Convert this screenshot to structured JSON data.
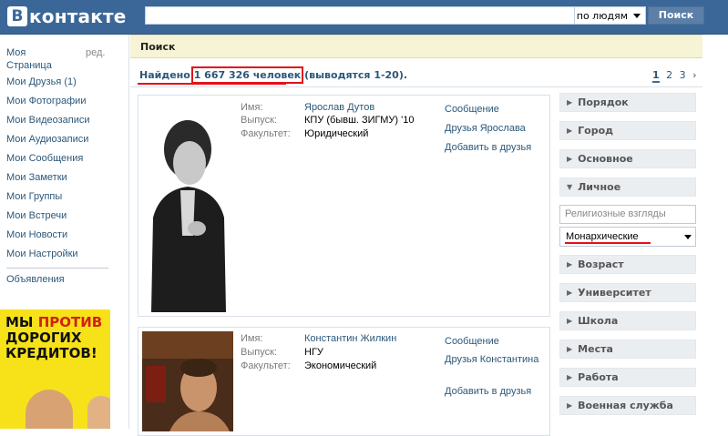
{
  "header": {
    "logo_letter": "В",
    "logo_text": "контакте",
    "search_value": "",
    "search_mode": "по людям",
    "search_button": "Поиск"
  },
  "sidebar": {
    "edit_label": "ред.",
    "items": [
      {
        "label": "Моя\nСтраница"
      },
      {
        "label": "Мои Друзья (1)"
      },
      {
        "label": "Мои Фотографии"
      },
      {
        "label": "Мои Видеозаписи"
      },
      {
        "label": "Мои Аудиозаписи"
      },
      {
        "label": "Мои Сообщения"
      },
      {
        "label": "Мои Заметки"
      },
      {
        "label": "Мои Группы"
      },
      {
        "label": "Мои Встречи"
      },
      {
        "label": "Мои Новости"
      },
      {
        "label": "Мои Настройки"
      }
    ],
    "ads_label": "Объявления"
  },
  "ad": {
    "line1_a": "МЫ ",
    "line1_b": "ПРОТИВ",
    "line2": "ДОРОГИХ",
    "line3": "КРЕДИТОВ!"
  },
  "page": {
    "title": "Поиск",
    "found_prefix": "Найдено",
    "found_count": "1 667 326 человек",
    "found_suffix": "(выводятся 1-20).",
    "pages": [
      "1",
      "2",
      "3",
      "›"
    ]
  },
  "results": [
    {
      "labels": {
        "name": "Имя:",
        "grad": "Выпуск:",
        "faculty": "Факультет:"
      },
      "name": "Ярослав Дутов",
      "graduation": "КПУ (бывш. ЗИГМУ) '10",
      "faculty": "Юридический",
      "actions": [
        "Сообщение",
        "Друзья Ярослава",
        "Добавить в друзья"
      ]
    },
    {
      "labels": {
        "name": "Имя:",
        "grad": "Выпуск:",
        "faculty": "Факультет:"
      },
      "name": "Константин Жилкин",
      "graduation": "НГУ",
      "faculty": "Экономический",
      "actions": [
        "Сообщение",
        "Друзья Константина",
        "Добавить в друзья"
      ]
    }
  ],
  "filters": {
    "sections": [
      "Порядок",
      "Город",
      "Основное",
      "Личное",
      "Возраст",
      "Университет",
      "Школа",
      "Места",
      "Работа",
      "Военная служба"
    ],
    "religion_placeholder": "Религиозные взгляды",
    "religion_value": "Монархические"
  },
  "colors": {
    "header_bg": "#3b6798",
    "link": "#2b587a",
    "highlight_red": "#e1121a",
    "page_head_bg": "#f7f3d5",
    "ad_yellow": "#f7e21a"
  }
}
